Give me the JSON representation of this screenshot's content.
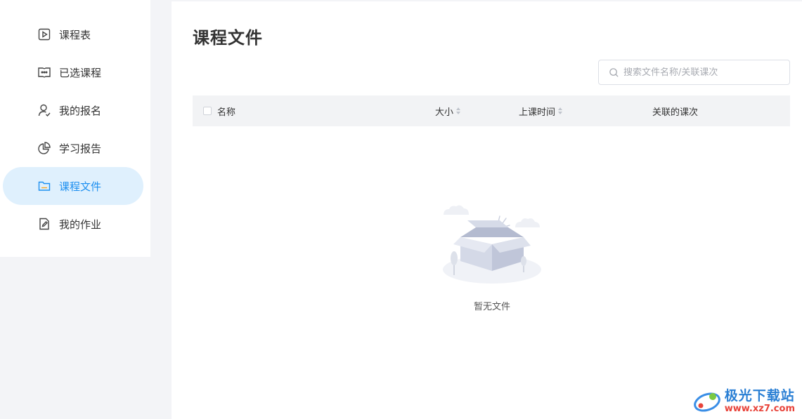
{
  "sidebar": {
    "items": [
      {
        "label": "课程表",
        "icon": "play-square-icon",
        "active": false
      },
      {
        "label": "已选课程",
        "icon": "book-open-icon",
        "active": false
      },
      {
        "label": "我的报名",
        "icon": "user-check-icon",
        "active": false
      },
      {
        "label": "学习报告",
        "icon": "pie-chart-icon",
        "active": false
      },
      {
        "label": "课程文件",
        "icon": "folder-icon",
        "active": true
      },
      {
        "label": "我的作业",
        "icon": "edit-doc-icon",
        "active": false
      }
    ]
  },
  "main": {
    "title": "课程文件",
    "search": {
      "placeholder": "搜索文件名称/关联课次",
      "value": ""
    },
    "table": {
      "columns": {
        "name": "名称",
        "size": "大小",
        "time": "上课时间",
        "lesson": "关联的课次"
      },
      "rows": []
    },
    "empty_text": "暂无文件"
  },
  "watermark": {
    "title": "极光下载站",
    "url": "www.xz7.com"
  },
  "colors": {
    "accent": "#1c8ff0",
    "active_bg": "#dff0fd",
    "page_bg": "#f3f4f7",
    "table_head_bg": "#f2f3f5"
  }
}
